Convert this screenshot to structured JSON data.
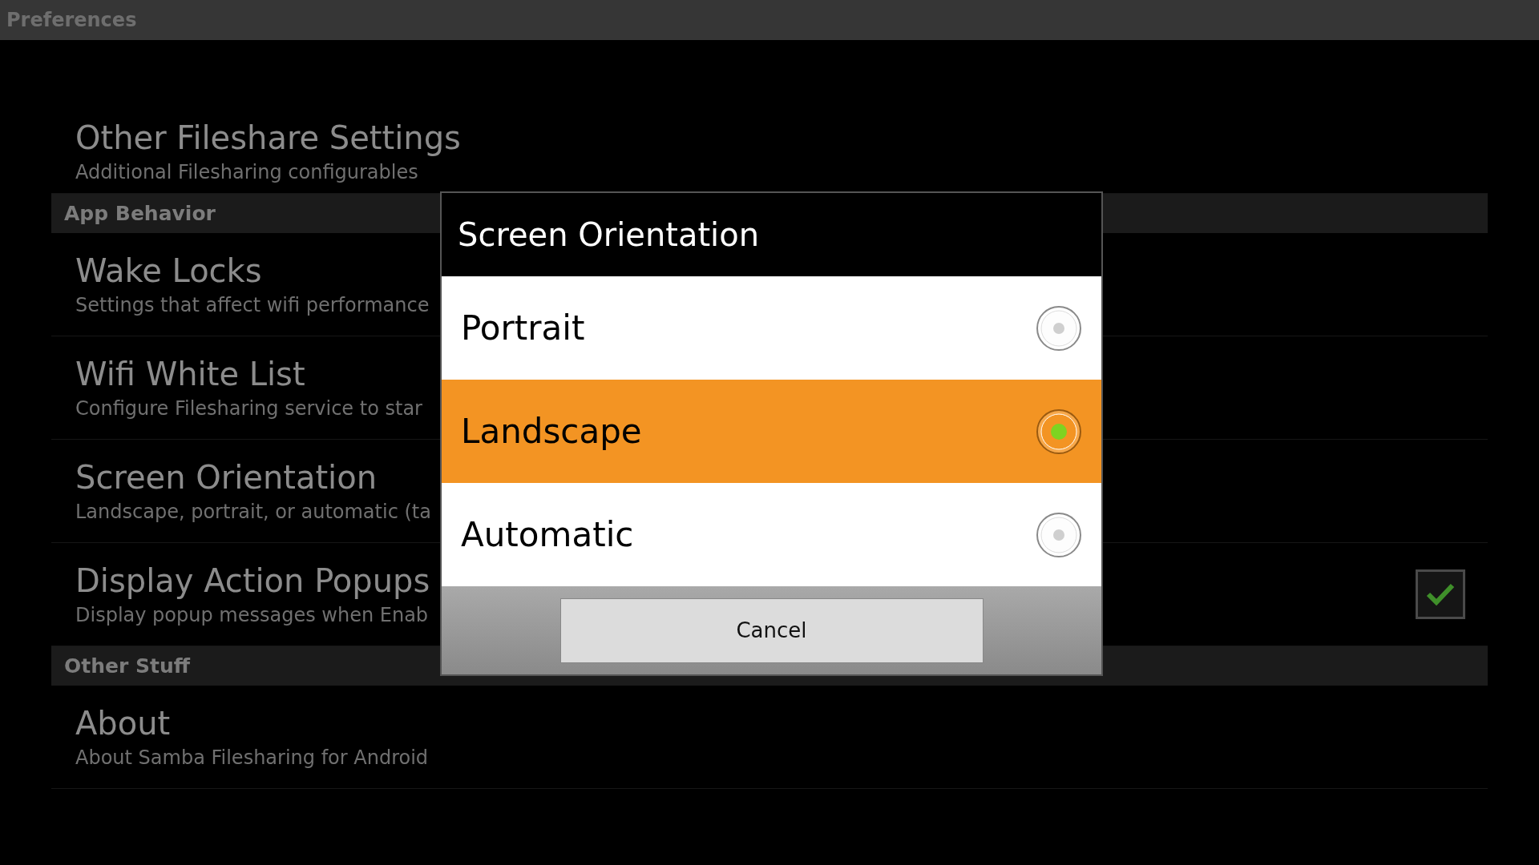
{
  "app_bar": {
    "title": "Preferences"
  },
  "preferences": [
    {
      "kind": "item",
      "title": "Other Fileshare Settings",
      "summary": "Additional Filesharing configurables"
    },
    {
      "kind": "category",
      "title": "App Behavior"
    },
    {
      "kind": "item",
      "title": "Wake Locks",
      "summary": "Settings that affect wifi performance"
    },
    {
      "kind": "item",
      "title": "Wifi White List",
      "summary": "Configure Filesharing service to star"
    },
    {
      "kind": "item",
      "title": "Screen Orientation",
      "summary": "Landscape, portrait, or automatic (ta"
    },
    {
      "kind": "check",
      "title": "Display Action Popups",
      "summary": "Display popup messages when Enab",
      "checked": true
    },
    {
      "kind": "category",
      "title": "Other Stuff"
    },
    {
      "kind": "item",
      "title": "About",
      "summary": "About Samba Filesharing for Android"
    }
  ],
  "dialog": {
    "title": "Screen Orientation",
    "options": [
      {
        "label": "Portrait",
        "selected": false
      },
      {
        "label": "Landscape",
        "selected": true
      },
      {
        "label": "Automatic",
        "selected": false
      }
    ],
    "buttons": [
      "Cancel"
    ]
  }
}
